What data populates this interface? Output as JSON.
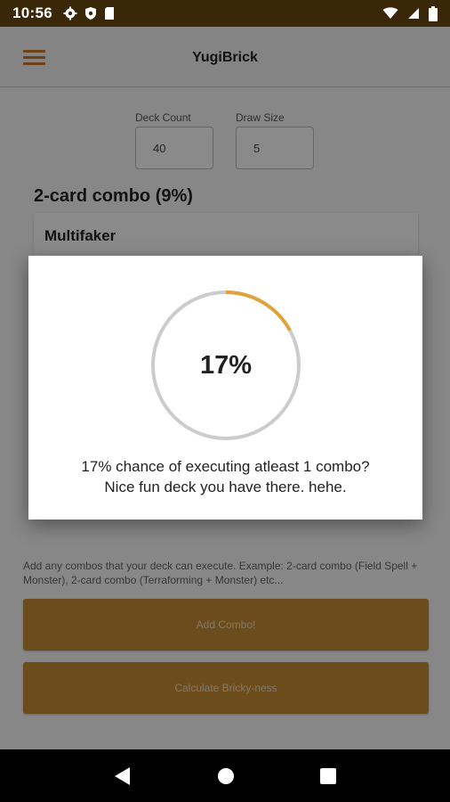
{
  "status_bar": {
    "time": "10:56",
    "left_icons": [
      "gear-icon",
      "shield-icon",
      "sd-card-icon"
    ],
    "right_icons": [
      "wifi-icon",
      "signal-icon",
      "battery-icon"
    ]
  },
  "app_bar": {
    "title": "YugiBrick",
    "menu_icon": "hamburger-menu-icon",
    "accent": "#c9772f"
  },
  "form": {
    "deck_count_label": "Deck Count",
    "deck_count_value": "40",
    "draw_size_label": "Draw Size",
    "draw_size_value": "5"
  },
  "combo": {
    "title": "2-card combo (9%)",
    "card_name": "Multifaker"
  },
  "help_text": "Add any combos that your deck can execute. Example: 2-card combo (Field Spell + Monster), 2-card combo (Terraforming + Monster) etc...",
  "buttons": {
    "add_combo": "Add Combo!",
    "calculate": "Calculate Bricky-ness",
    "color": "#c88b34"
  },
  "dialog": {
    "progress_fraction": 0.17,
    "progress_label": "17%",
    "progress_color": "#e0a23a",
    "track_color": "#cccccc",
    "message_line1": "17% chance of executing atleast 1 combo?",
    "message_line2": "Nice fun deck you have there. hehe."
  },
  "nav_bar": {
    "icons": [
      "back-icon",
      "home-icon",
      "recents-icon"
    ]
  }
}
